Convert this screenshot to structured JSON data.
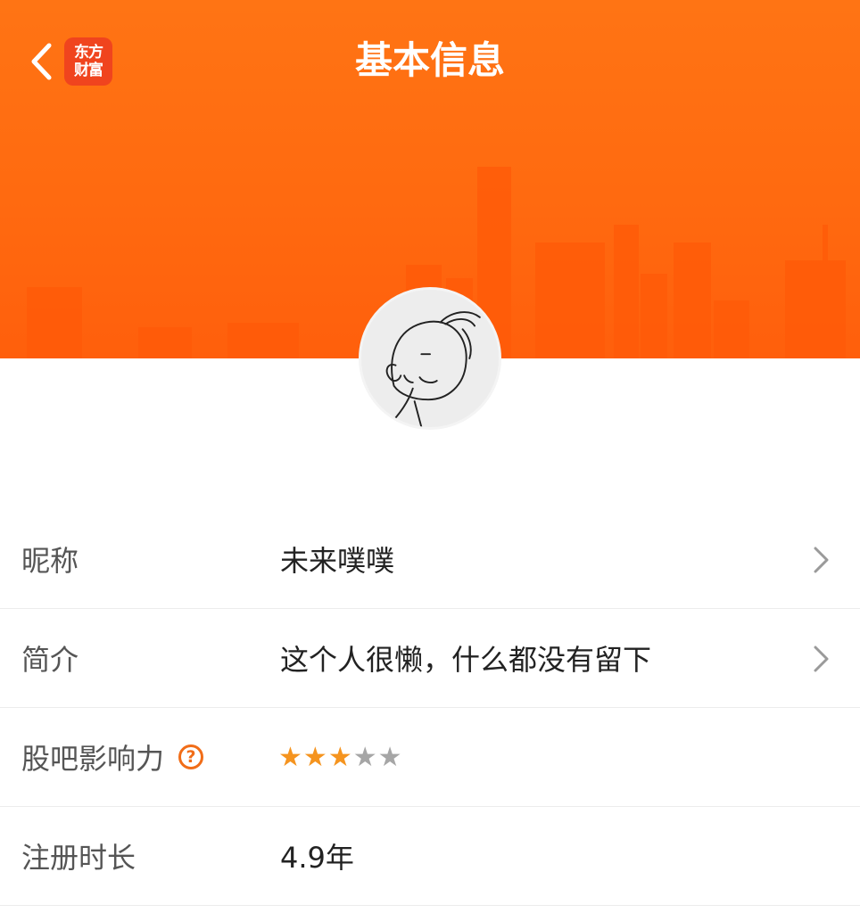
{
  "header": {
    "title": "基本信息",
    "logo_line1": "东方",
    "logo_line2": "财富",
    "back_icon": "chevron-left-icon"
  },
  "colors": {
    "header_orange": "#ff6a10",
    "logo_red": "#f0441e",
    "accent_orange": "#f16d18",
    "star_active": "#f5941f",
    "star_inactive": "#a6a6a6"
  },
  "profile": {
    "rows": [
      {
        "label": "昵称",
        "value": "未来噗噗",
        "has_arrow": true
      },
      {
        "label": "简介",
        "value": "这个人很懒，什么都没有留下",
        "has_arrow": true
      },
      {
        "label": "股吧影响力",
        "help_icon": "?",
        "rating": 3,
        "rating_max": 5
      },
      {
        "label": "注册时长",
        "value": "4.9年"
      }
    ]
  }
}
